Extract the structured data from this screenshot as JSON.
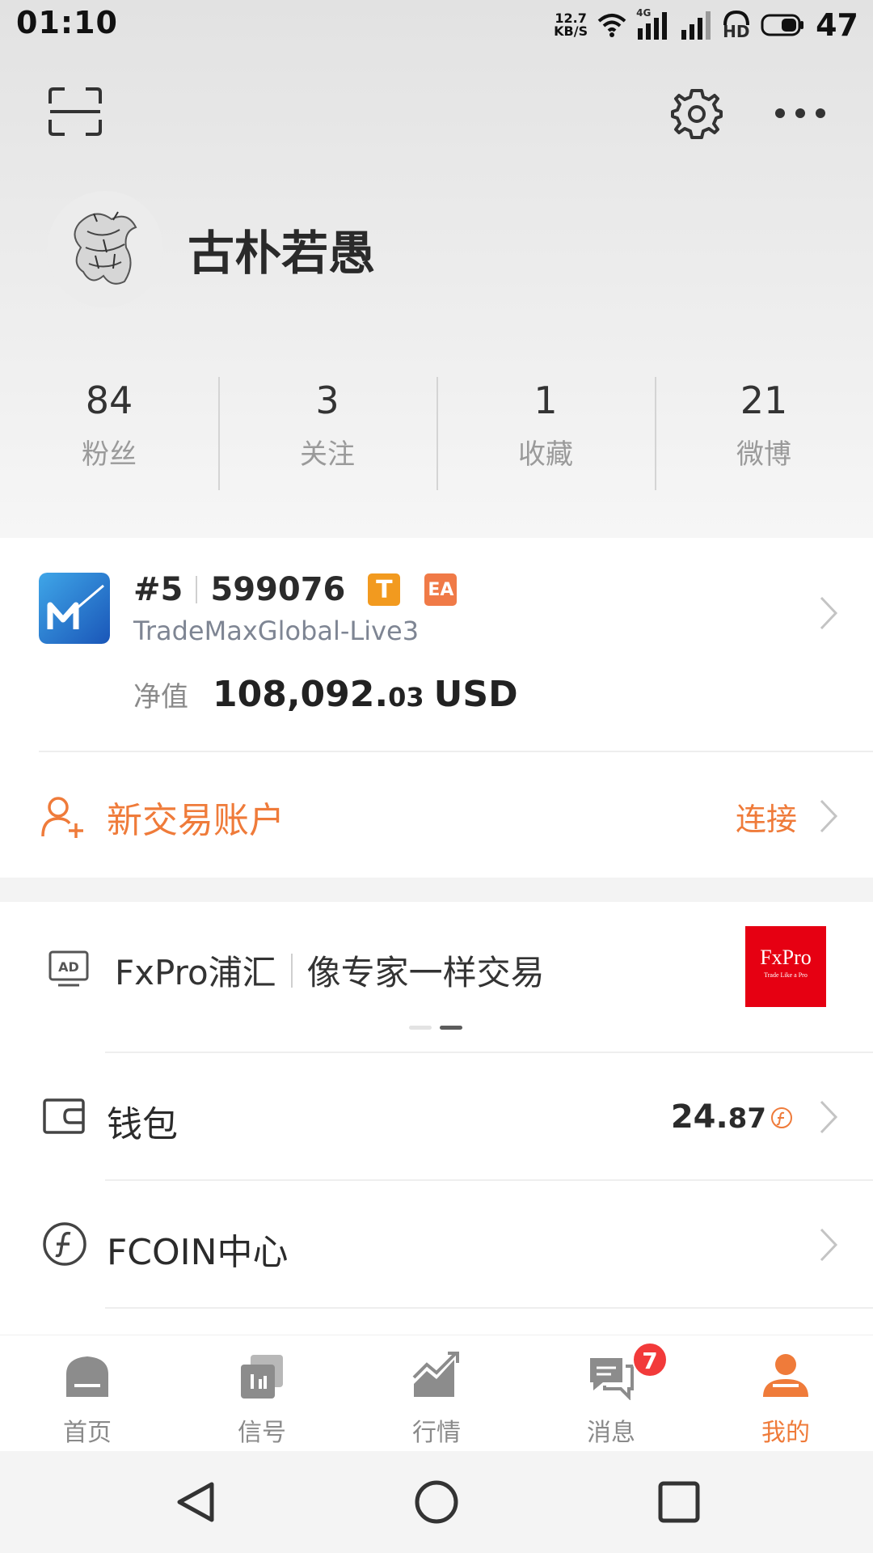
{
  "status_bar": {
    "time": "01:10",
    "net_speed_value": "12.7",
    "net_speed_unit": "KB/S",
    "network_type": "4G",
    "hd_label": "HD",
    "battery": "47"
  },
  "header": {
    "icons": [
      "scan-icon",
      "settings-icon",
      "more-icon"
    ]
  },
  "profile": {
    "username": "古朴若愚"
  },
  "stats": [
    {
      "value": "84",
      "label": "粉丝"
    },
    {
      "value": "3",
      "label": "关注"
    },
    {
      "value": "1",
      "label": "收藏"
    },
    {
      "value": "21",
      "label": "微博"
    }
  ],
  "account": {
    "rank": "#5",
    "number": "599076",
    "badge_t": "T",
    "badge_ea": "EA",
    "server": "TradeMaxGlobal-Live3",
    "equity_label": "净值",
    "equity_int": "108,092.",
    "equity_dec": "03",
    "equity_unit": "USD"
  },
  "new_account": {
    "label": "新交易账户",
    "action": "连接"
  },
  "ad": {
    "brand": "FxPro浦汇",
    "slogan": "像专家一样交易",
    "logo_title": "FxPro",
    "logo_sub": "Trade Like a Pro",
    "carousel_pages": 2,
    "carousel_active": 2
  },
  "wallet": {
    "label": "钱包",
    "value_int": "24.",
    "value_dec": "87"
  },
  "fcoin": {
    "label": "FCOIN中心"
  },
  "tabs": [
    {
      "label": "首页",
      "icon": "home-icon"
    },
    {
      "label": "信号",
      "icon": "signal-icon"
    },
    {
      "label": "行情",
      "icon": "market-icon"
    },
    {
      "label": "消息",
      "icon": "message-icon",
      "badge": "7"
    },
    {
      "label": "我的",
      "icon": "profile-icon",
      "active": true
    }
  ],
  "colors": {
    "accent": "#ef7b3a",
    "badge_red": "#f23a3a",
    "badge_t": "#f29a1f",
    "badge_ea": "#f07a47",
    "ad_logo_bg": "#e60012"
  }
}
